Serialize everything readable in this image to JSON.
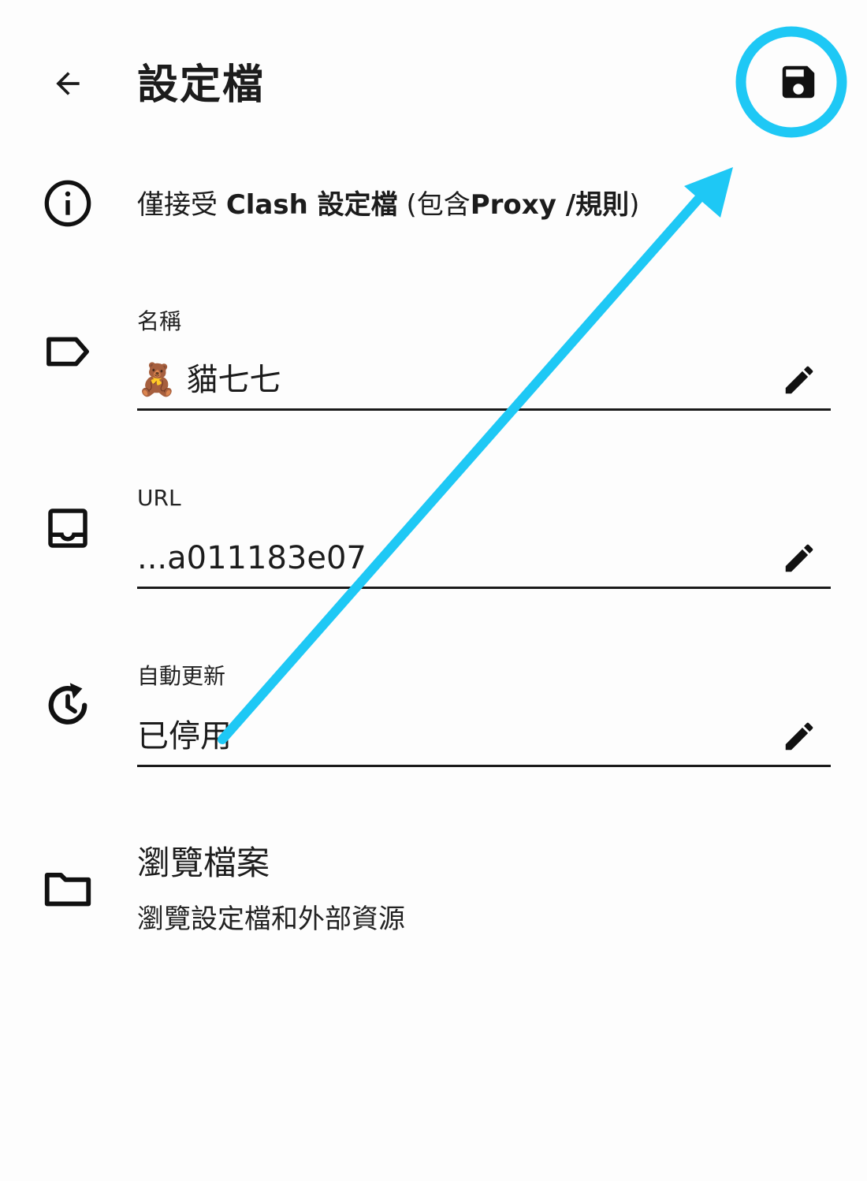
{
  "appbar": {
    "title": "設定檔",
    "back_icon": "arrow-left-icon",
    "save_icon": "floppy-disk-icon"
  },
  "info": {
    "icon": "info-circle-icon",
    "prefix": "僅接受 ",
    "bold1": "Clash 設定檔",
    "mid": " (包含",
    "bold2": "Proxy /規則",
    "suffix": ")"
  },
  "fields": {
    "name": {
      "icon": "label-tag-icon",
      "label": "名稱",
      "value": "🧸 貓七七"
    },
    "url": {
      "icon": "inbox-tray-icon",
      "label": "URL",
      "value": "...a011183e07"
    },
    "auto_update": {
      "icon": "history-clock-icon",
      "label": "自動更新",
      "value": "已停用"
    }
  },
  "browse": {
    "icon": "folder-icon",
    "title": "瀏覽檔案",
    "subtitle": "瀏覽設定檔和外部資源"
  },
  "annotation": {
    "color": "#1ec8f5"
  }
}
